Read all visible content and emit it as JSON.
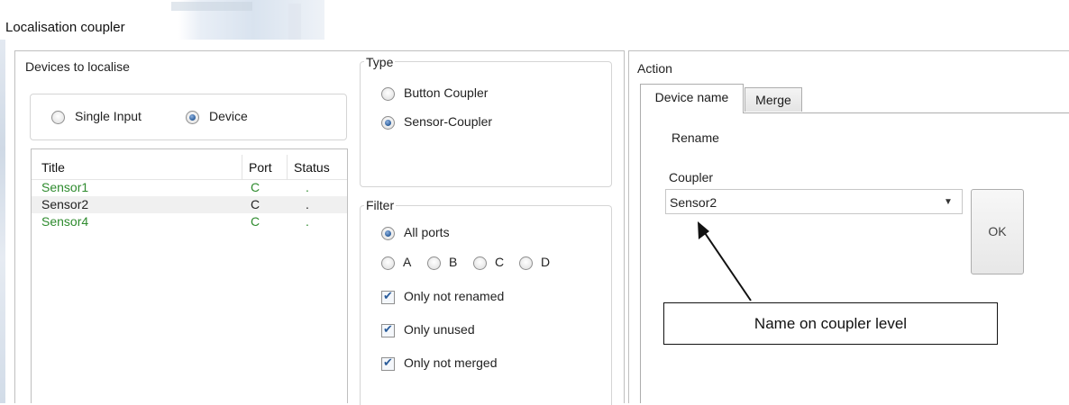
{
  "window": {
    "title": "Localisation coupler"
  },
  "devices": {
    "group_label": "Devices to localise",
    "mode_options": [
      {
        "label": "Single Input",
        "checked": false
      },
      {
        "label": "Device",
        "checked": true
      }
    ],
    "columns": [
      "Title",
      "Port",
      "Status"
    ],
    "rows": [
      {
        "title": "Sensor1",
        "port": "C",
        "status": ".",
        "color": "#2e8b2e"
      },
      {
        "title": "Sensor2",
        "port": "C",
        "status": ".",
        "color": "#222222"
      },
      {
        "title": "Sensor4",
        "port": "C",
        "status": ".",
        "color": "#2e8b2e"
      }
    ]
  },
  "type": {
    "group_label": "Type",
    "options": [
      {
        "label": "Button Coupler",
        "checked": false
      },
      {
        "label": "Sensor-Coupler",
        "checked": true
      }
    ]
  },
  "filter": {
    "group_label": "Filter",
    "all_ports": {
      "label": "All ports",
      "checked": true
    },
    "ports": [
      {
        "label": "A",
        "checked": false
      },
      {
        "label": "B",
        "checked": false
      },
      {
        "label": "C",
        "checked": false
      },
      {
        "label": "D",
        "checked": false
      }
    ],
    "checks": [
      {
        "label": "Only not renamed",
        "checked": true
      },
      {
        "label": "Only unused",
        "checked": true
      },
      {
        "label": "Only not merged",
        "checked": true
      }
    ]
  },
  "action": {
    "group_label": "Action",
    "tabs": [
      {
        "label": "Device name",
        "active": true
      },
      {
        "label": "Merge",
        "active": false
      }
    ],
    "rename_label": "Rename",
    "coupler_label": "Coupler",
    "coupler_value": "Sensor2",
    "ok_label": "OK"
  },
  "annotation": {
    "text": "Name on coupler level"
  }
}
